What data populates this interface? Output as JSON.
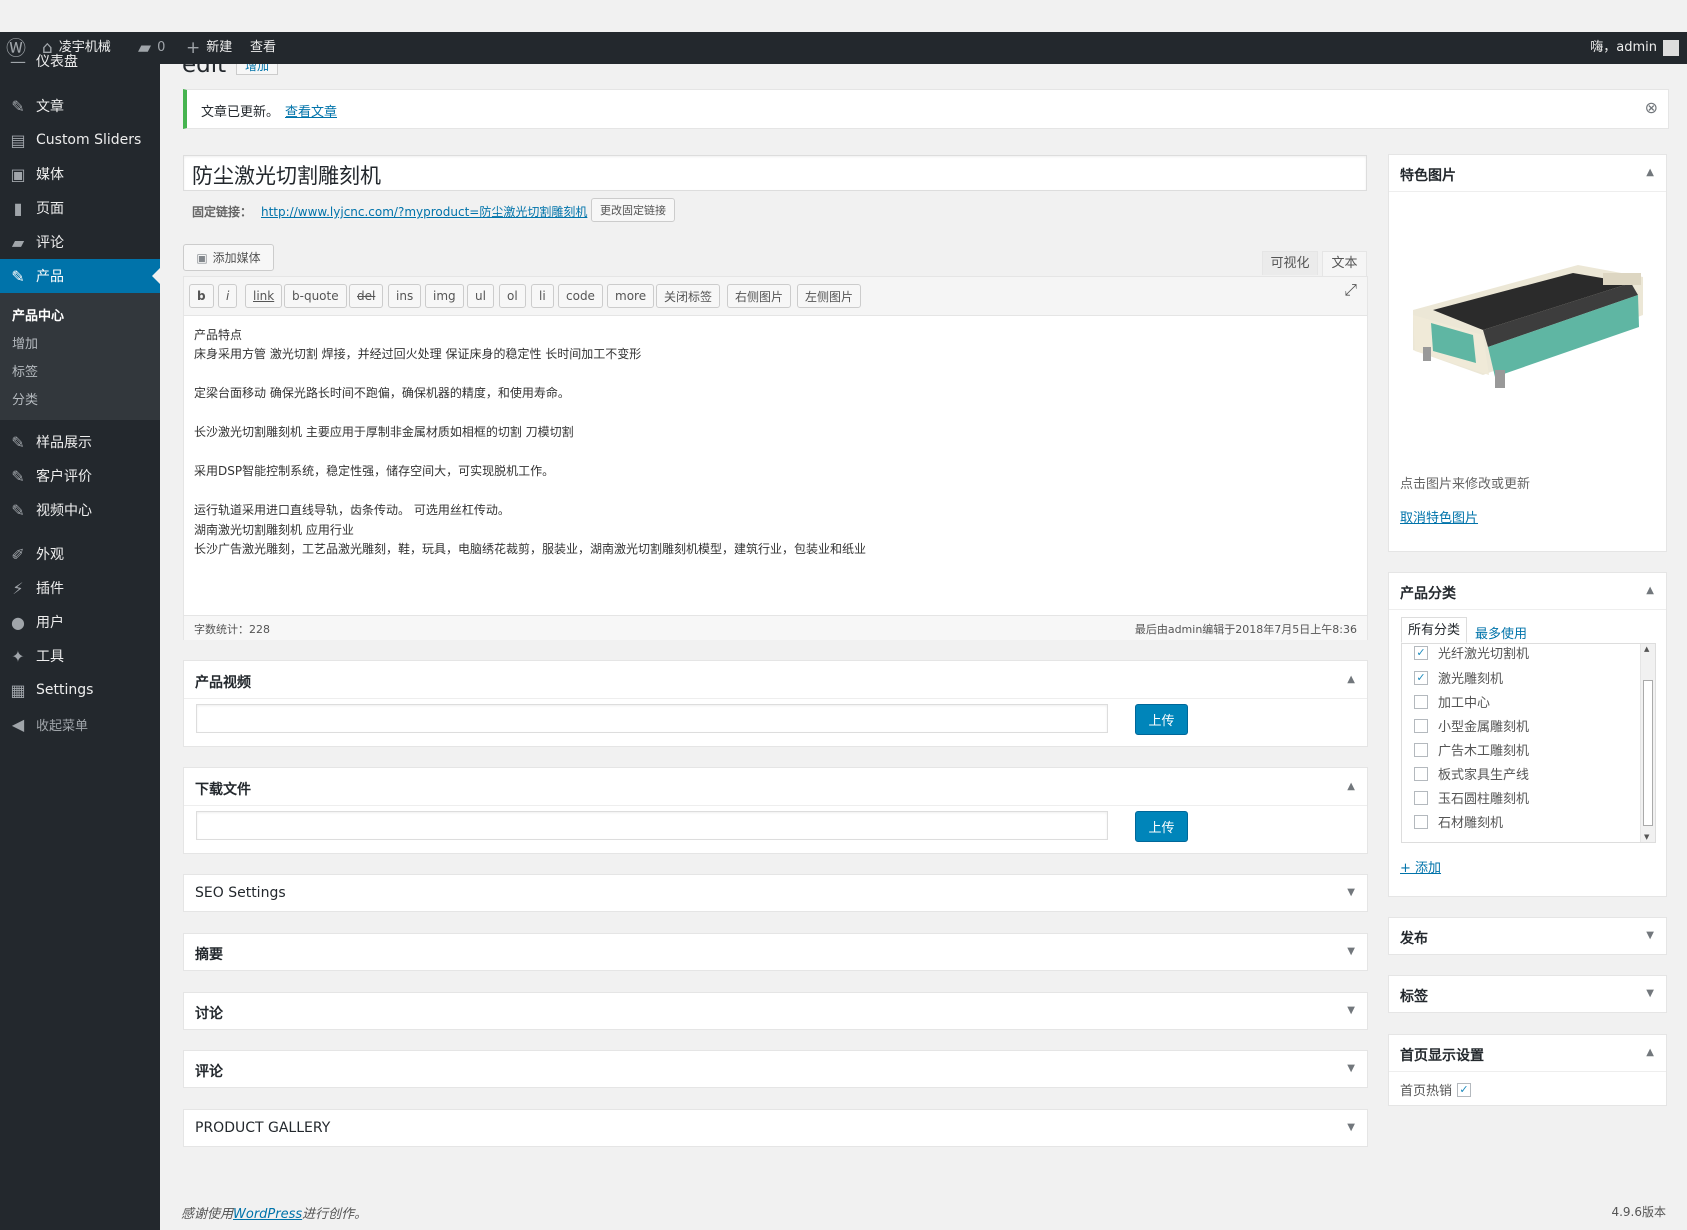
{
  "adminbar": {
    "site_name": "凌宇机械",
    "comments_count": "0",
    "new_label": "新建",
    "view_label": "查看",
    "greeting": "嗨，admin"
  },
  "sidebar": {
    "dashboard_cut": "仪表盘",
    "items": [
      "文章",
      "Custom Sliders",
      "媒体",
      "页面",
      "评论",
      "产品",
      "样品展示",
      "客户评价",
      "视频中心",
      "外观",
      "插件",
      "用户",
      "工具",
      "Settings",
      "收起菜单"
    ],
    "submenu": [
      "产品中心",
      "增加",
      "标签",
      "分类"
    ]
  },
  "header": {
    "title_cut": "edit",
    "add_button": "增加"
  },
  "notice": {
    "text": "文章已更新。",
    "link": "查看文章"
  },
  "post": {
    "title": "防尘激光切割雕刻机",
    "permalink_label": "固定链接：",
    "permalink_url": "http://www.lyjcnc.com/?myproduct=防尘激光切割雕刻机",
    "change_permalink": "更改固定链接",
    "add_media": "添加媒体",
    "tab_visual": "可视化",
    "tab_text": "文本",
    "quicktags": [
      "b",
      "i",
      "link",
      "b-quote",
      "del",
      "ins",
      "img",
      "ul",
      "ol",
      "li",
      "code",
      "more",
      "关闭标签",
      "右侧图片",
      "左侧图片"
    ],
    "content": [
      "产品特点",
      "床身采用方管 激光切割 焊接，并经过回火处理 保证床身的稳定性 长时间加工不变形",
      "",
      "定梁台面移动 确保光路长时间不跑偏，确保机器的精度，和使用寿命。",
      "",
      "长沙激光切割雕刻机 主要应用于厚制非金属材质如相框的切割 刀模切割",
      "",
      "采用DSP智能控制系统，稳定性强，储存空间大，可实现脱机工作。",
      "",
      "运行轨道采用进口直线导轨，齿条传动。 可选用丝杠传动。",
      "湖南激光切割雕刻机 应用行业",
      "长沙广告激光雕刻，工艺品激光雕刻，鞋，玩具，电脑绣花裁剪，服装业，湖南激光切割雕刻机模型，建筑行业，包装业和纸业"
    ],
    "word_count": "字数统计：228",
    "last_edit": "最后由admin编辑于2018年7月5日上午8:36"
  },
  "metaboxes": {
    "video": {
      "title": "产品视频",
      "upload": "上传"
    },
    "download": {
      "title": "下载文件",
      "upload": "上传"
    },
    "seo": "SEO Settings",
    "excerpt": "摘要",
    "discussion": "讨论",
    "comments": "评论",
    "gallery": "PRODUCT GALLERY"
  },
  "side": {
    "featured": {
      "title": "特色图片",
      "hint": "点击图片来修改或更新",
      "remove": "取消特色图片"
    },
    "category": {
      "title": "产品分类",
      "tab_all": "所有分类",
      "tab_popular": "最多使用",
      "items": [
        {
          "label": "光纤激光切割机",
          "checked": true
        },
        {
          "label": "激光雕刻机",
          "checked": true
        },
        {
          "label": "加工中心",
          "checked": false
        },
        {
          "label": "小型金属雕刻机",
          "checked": false
        },
        {
          "label": "广告木工雕刻机",
          "checked": false
        },
        {
          "label": "板式家具生产线",
          "checked": false
        },
        {
          "label": "玉石圆柱雕刻机",
          "checked": false
        },
        {
          "label": "石材雕刻机",
          "checked": false
        }
      ],
      "add_new": "+ 添加"
    },
    "publish": "发布",
    "tags": "标签",
    "home": {
      "title": "首页显示设置",
      "hot_label": "首页热销"
    }
  },
  "footer": {
    "thanks_prefix": "感谢使用",
    "wp_link": "WordPress",
    "thanks_suffix": "进行创作。",
    "version": "4.9.6版本"
  },
  "colors": {
    "accent": "#0073aa",
    "sidebar": "#23282d",
    "notice_green": "#46b450"
  }
}
